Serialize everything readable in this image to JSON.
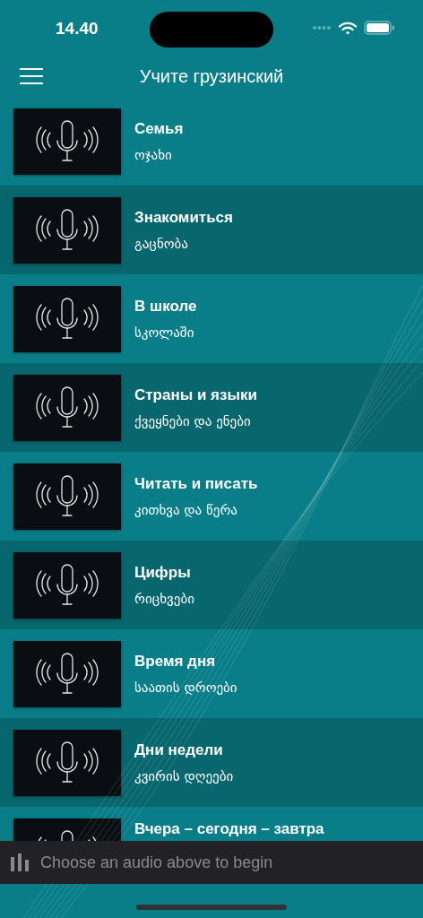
{
  "status_bar": {
    "time": "14.40"
  },
  "nav": {
    "title": "Учите грузинский"
  },
  "lessons": [
    {
      "title": "Семья",
      "subtitle": "ოჯახი"
    },
    {
      "title": "Знакомиться",
      "subtitle": "გაცნობა"
    },
    {
      "title": "В школе",
      "subtitle": "სკოლაში"
    },
    {
      "title": "Страны и языки",
      "subtitle": "ქვეყნები და ენები"
    },
    {
      "title": "Читать и писать",
      "subtitle": "კითხვა და წერა"
    },
    {
      "title": "Цифры",
      "subtitle": "რიცხვები"
    },
    {
      "title": "Время дня",
      "subtitle": "საათის დროები"
    },
    {
      "title": "Дни недели",
      "subtitle": "კვირის დღეები"
    },
    {
      "title": "Вчера – сегодня – завтра"
    }
  ],
  "player": {
    "message": "Choose an audio above to begin"
  }
}
